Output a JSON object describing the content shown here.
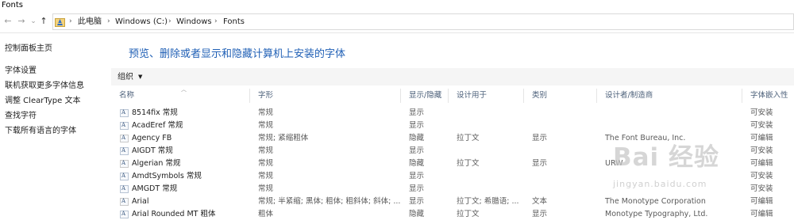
{
  "window": {
    "title": "Fonts"
  },
  "address": {
    "crumbs": [
      "此电脑",
      "Windows (C:)",
      "Windows",
      "Fonts"
    ],
    "sep": "›"
  },
  "nav": {
    "back": "←",
    "forward": "→",
    "recent": "⌄",
    "up": "↑"
  },
  "sidebar": {
    "items": [
      {
        "label": "控制面板主页"
      },
      {
        "label": "字体设置"
      },
      {
        "label": "联机获取更多字体信息"
      },
      {
        "label": "调整 ClearType 文本"
      },
      {
        "label": "查找字符"
      },
      {
        "label": "下载所有语言的字体"
      }
    ]
  },
  "main": {
    "heading": "预览、删除或者显示和隐藏计算机上安装的字体",
    "organize_label": "组织",
    "organize_caret": "▼",
    "sort_caret": "︿",
    "columns": [
      "名称",
      "字形",
      "显示/隐藏",
      "设计用于",
      "类别",
      "设计者/制造商",
      "字体嵌入性"
    ],
    "rows": [
      {
        "name": "8514fix 常规",
        "style": "常规",
        "show": "显示",
        "designed": "",
        "category": "",
        "designer": "",
        "embed": "可安装",
        "icon": "A"
      },
      {
        "name": "AcadEref 常规",
        "style": "常规",
        "show": "显示",
        "designed": "",
        "category": "",
        "designer": "",
        "embed": "可安装",
        "icon": "A"
      },
      {
        "name": "Agency FB",
        "style": "常规; 紧缩粗体",
        "show": "隐藏",
        "designed": "拉丁文",
        "category": "显示",
        "designer": "The Font Bureau, Inc.",
        "embed": "可编辑",
        "icon": "A"
      },
      {
        "name": "AIGDT 常规",
        "style": "常规",
        "show": "显示",
        "designed": "",
        "category": "",
        "designer": "",
        "embed": "可安装",
        "icon": "A"
      },
      {
        "name": "Algerian 常规",
        "style": "常规",
        "show": "隐藏",
        "designed": "拉丁文",
        "category": "显示",
        "designer": "URW",
        "embed": "可编辑",
        "icon": "A"
      },
      {
        "name": "AmdtSymbols 常规",
        "style": "常规",
        "show": "显示",
        "designed": "",
        "category": "",
        "designer": "",
        "embed": "可安装",
        "icon": "A"
      },
      {
        "name": "AMGDT 常规",
        "style": "常规",
        "show": "显示",
        "designed": "",
        "category": "",
        "designer": "",
        "embed": "可安装",
        "icon": "A"
      },
      {
        "name": "Arial",
        "style": "常规; 半紧缩; 黑体; 粗体; 粗斜体; 斜体; ...",
        "show": "显示",
        "designed": "拉丁文; 希腊语; ...",
        "category": "文本",
        "designer": "The Monotype Corporation",
        "embed": "可编辑",
        "icon": "A"
      },
      {
        "name": "Arial Rounded MT 粗体",
        "style": "粗体",
        "show": "隐藏",
        "designed": "拉丁文",
        "category": "显示",
        "designer": "Monotype Typography, Ltd.",
        "embed": "可编辑",
        "icon": "A"
      }
    ]
  },
  "watermark": {
    "brand": "Bai 经验",
    "url": "jingyan.baidu.com"
  }
}
